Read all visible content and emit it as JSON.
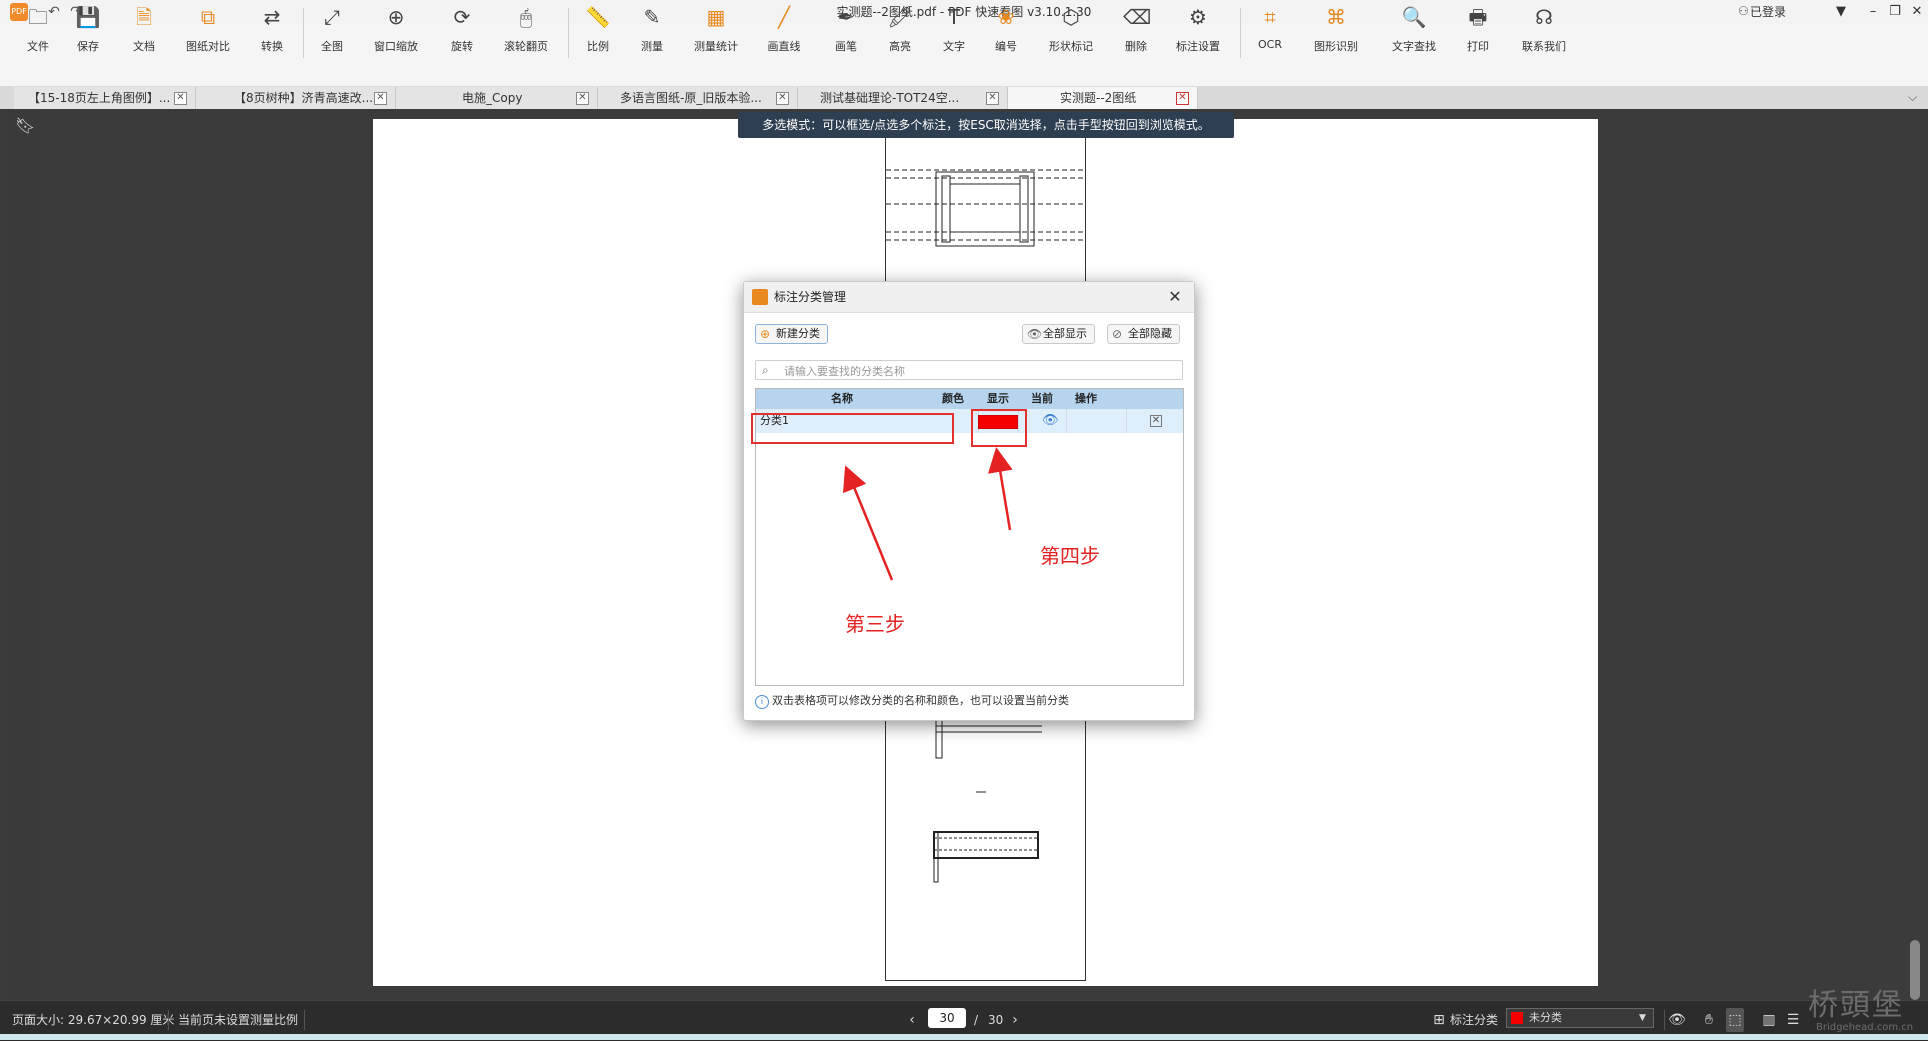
{
  "titlebar": {
    "title": "实测题--2图纸.pdf - PDF 快速看图 v3.10.1.30",
    "logo_text": "PDF",
    "login": "已登录"
  },
  "ribbon": {
    "items": [
      {
        "label": "文件",
        "icon": "folder-icon"
      },
      {
        "label": "保存",
        "icon": "save-icon"
      },
      {
        "label": "文档",
        "icon": "document-icon"
      },
      {
        "label": "图纸对比",
        "icon": "compare-icon"
      },
      {
        "label": "转换",
        "icon": "convert-icon"
      },
      {
        "label": "全图",
        "icon": "fit-all-icon"
      },
      {
        "label": "窗口缩放",
        "icon": "zoom-window-icon"
      },
      {
        "label": "旋转",
        "icon": "rotate-icon"
      },
      {
        "label": "滚轮翻页",
        "icon": "mouse-wheel-icon"
      },
      {
        "label": "比例",
        "icon": "scale-icon"
      },
      {
        "label": "测量",
        "icon": "measure-icon"
      },
      {
        "label": "测量统计",
        "icon": "measure-stats-icon"
      },
      {
        "label": "画直线",
        "icon": "line-icon"
      },
      {
        "label": "画笔",
        "icon": "pen-icon"
      },
      {
        "label": "高亮",
        "icon": "highlighter-icon"
      },
      {
        "label": "文字",
        "icon": "text-icon"
      },
      {
        "label": "编号",
        "icon": "numbering-icon"
      },
      {
        "label": "形状标记",
        "icon": "shape-mark-icon"
      },
      {
        "label": "删除",
        "icon": "eraser-icon"
      },
      {
        "label": "标注设置",
        "icon": "annotation-settings-icon"
      },
      {
        "label": "OCR",
        "icon": "ocr-icon"
      },
      {
        "label": "图形识别",
        "icon": "shape-recognition-icon"
      },
      {
        "label": "文字查找",
        "icon": "search-icon"
      },
      {
        "label": "打印",
        "icon": "print-icon"
      },
      {
        "label": "联系我们",
        "icon": "headset-icon"
      }
    ]
  },
  "tabs": [
    {
      "label": "【15-18页左上角图例】..."
    },
    {
      "label": "【8页树种】济青高速改..."
    },
    {
      "label": "电施_Copy"
    },
    {
      "label": "多语言图纸-原_旧版本验..."
    },
    {
      "label": "测试基础理论-TOT24空..."
    },
    {
      "label": "实测题--2图纸"
    }
  ],
  "hint": "多选模式：可以框选/点选多个标注，按ESC取消选择，点击手型按钮回到浏览模式。",
  "dialog": {
    "title": "标注分类管理",
    "new_button": "新建分类",
    "show_all": "全部显示",
    "hide_all": "全部隐藏",
    "search_placeholder": "请输入要查找的分类名称",
    "columns": {
      "name": "名称",
      "color": "颜色",
      "show": "显示",
      "current": "当前",
      "action": "操作"
    },
    "rows": [
      {
        "name": "分类1",
        "color": "#f40000"
      }
    ],
    "note": "双击表格项可以修改分类的名称和颜色，也可以设置当前分类"
  },
  "annotations": {
    "step3": "第三步",
    "step4": "第四步"
  },
  "statusbar": {
    "page_size": "页面大小: 29.67×20.99 厘米",
    "scale_note": "当前页未设置测量比例",
    "current_page": "30",
    "separator": "/",
    "total_pages": "30",
    "category_label": "标注分类",
    "category_value": "未分类"
  },
  "watermark": {
    "main": "桥頭堡",
    "sub": "Bridgehead.com.cn"
  },
  "colors": {
    "accent": "#e7891f",
    "highlight_red": "#e53030",
    "category_red": "#f40000",
    "table_header": "#b7d4ee"
  }
}
